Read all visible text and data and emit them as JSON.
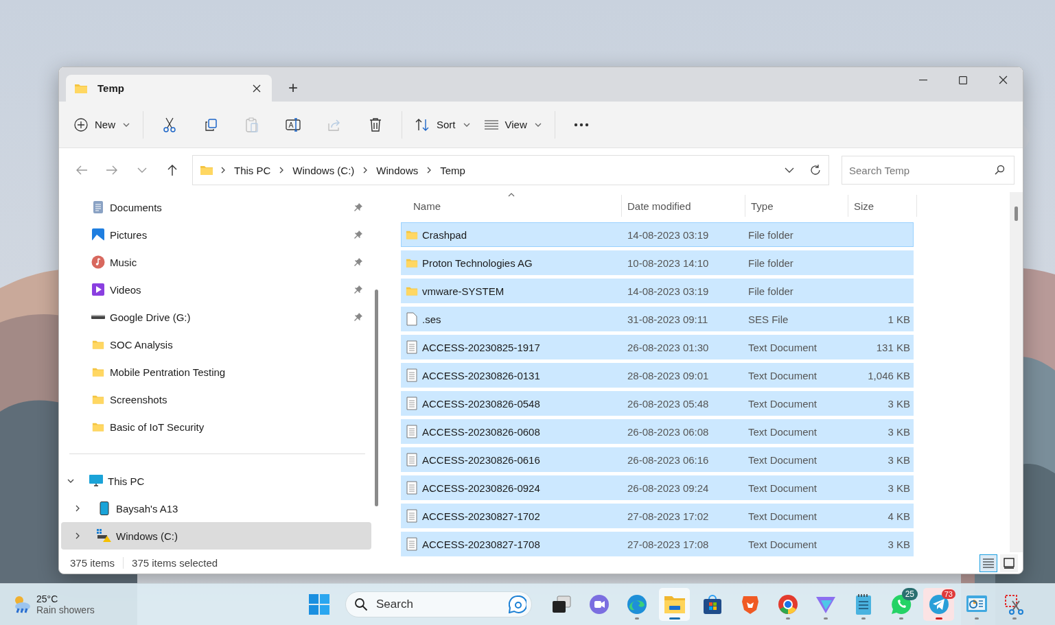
{
  "window": {
    "tab": {
      "title": "Temp",
      "selected": true
    },
    "new_tab": "+"
  },
  "toolbar": [
    {
      "kind": "new",
      "label": "New",
      "disabled": false
    },
    {
      "kind": "cut",
      "disabled": false
    },
    {
      "kind": "copy",
      "disabled": false
    },
    {
      "kind": "paste",
      "disabled": true
    },
    {
      "kind": "rename",
      "disabled": false
    },
    {
      "kind": "share",
      "disabled": true
    },
    {
      "kind": "delete",
      "disabled": false
    },
    {
      "kind": "sort",
      "label": "Sort",
      "disabled": false
    },
    {
      "kind": "view",
      "label": "View",
      "disabled": false
    },
    {
      "kind": "more",
      "disabled": false
    }
  ],
  "navigation": [
    {
      "kind": "back",
      "disabled": true
    },
    {
      "kind": "forward",
      "disabled": true
    },
    {
      "kind": "recent",
      "disabled": true
    },
    {
      "kind": "up",
      "disabled": false
    }
  ],
  "breadcrumb": [
    "This PC",
    "Windows (C:)",
    "Windows",
    "Temp"
  ],
  "search": {
    "placeholder": "Search Temp"
  },
  "sidebar": {
    "quick_access": [
      {
        "label": "Documents",
        "kind": "documents",
        "pinned": true
      },
      {
        "label": "Pictures",
        "kind": "pictures",
        "pinned": true
      },
      {
        "label": "Music",
        "kind": "music",
        "pinned": true
      },
      {
        "label": "Videos",
        "kind": "videos",
        "pinned": true
      },
      {
        "label": "Google Drive (G:)",
        "kind": "drive",
        "pinned": true
      },
      {
        "label": "SOC Analysis",
        "kind": "folder",
        "pinned": false
      },
      {
        "label": "Mobile Pentration Testing",
        "kind": "folder",
        "pinned": false
      },
      {
        "label": "Screenshots",
        "kind": "folder",
        "pinned": false
      },
      {
        "label": "Basic of IoT Security",
        "kind": "folder",
        "pinned": false
      }
    ],
    "tree": [
      {
        "label": "This PC",
        "kind": "pc",
        "expanded": true,
        "selected": false,
        "children": [
          {
            "label": "Baysah's A13",
            "kind": "phone",
            "expanded": false,
            "selected": false
          },
          {
            "label": "Windows (C:)",
            "kind": "system-drive",
            "expanded": false,
            "selected": true
          }
        ]
      }
    ]
  },
  "table": {
    "columns": [
      {
        "label": "Name",
        "sorted": true
      },
      {
        "label": "Date modified",
        "sorted": false
      },
      {
        "label": "Type",
        "sorted": false
      },
      {
        "label": "Size",
        "sorted": false
      }
    ],
    "rows": [
      {
        "kind": "folder",
        "name": "Crashpad",
        "date": "14-08-2023 03:19",
        "type": "File folder",
        "selected": true,
        "focused": true
      },
      {
        "kind": "folder",
        "name": "Proton Technologies AG",
        "date": "10-08-2023 14:10",
        "type": "File folder",
        "selected": true,
        "focused": false
      },
      {
        "kind": "folder",
        "name": "vmware-SYSTEM",
        "date": "14-08-2023 03:19",
        "type": "File folder",
        "selected": true,
        "focused": false
      },
      {
        "kind": "file",
        "name": ".ses",
        "date": "31-08-2023 09:11",
        "type": "SES File",
        "size": "1 KB",
        "selected": true,
        "focused": false
      },
      {
        "kind": "text",
        "name": "ACCESS-20230825-1917",
        "date": "26-08-2023 01:30",
        "type": "Text Document",
        "size": "131 KB",
        "selected": true,
        "focused": false
      },
      {
        "kind": "text",
        "name": "ACCESS-20230826-0131",
        "date": "28-08-2023 09:01",
        "type": "Text Document",
        "size": "1,046 KB",
        "selected": true,
        "focused": false
      },
      {
        "kind": "text",
        "name": "ACCESS-20230826-0548",
        "date": "26-08-2023 05:48",
        "type": "Text Document",
        "size": "3 KB",
        "selected": true,
        "focused": false
      },
      {
        "kind": "text",
        "name": "ACCESS-20230826-0608",
        "date": "26-08-2023 06:08",
        "type": "Text Document",
        "size": "3 KB",
        "selected": true,
        "focused": false
      },
      {
        "kind": "text",
        "name": "ACCESS-20230826-0616",
        "date": "26-08-2023 06:16",
        "type": "Text Document",
        "size": "3 KB",
        "selected": true,
        "focused": false
      },
      {
        "kind": "text",
        "name": "ACCESS-20230826-0924",
        "date": "26-08-2023 09:24",
        "type": "Text Document",
        "size": "3 KB",
        "selected": true,
        "focused": false
      },
      {
        "kind": "text",
        "name": "ACCESS-20230827-1702",
        "date": "27-08-2023 17:02",
        "type": "Text Document",
        "size": "4 KB",
        "selected": true,
        "focused": false
      },
      {
        "kind": "text",
        "name": "ACCESS-20230827-1708",
        "date": "27-08-2023 17:08",
        "type": "Text Document",
        "size": "3 KB",
        "selected": true,
        "focused": false
      }
    ]
  },
  "status_bar": {
    "items": "375 items",
    "selection": "375 items selected",
    "views": [
      {
        "kind": "details",
        "selected": true
      },
      {
        "kind": "tiles",
        "selected": false
      }
    ]
  },
  "taskbar": {
    "weather": {
      "temperature": "25°C",
      "condition": "Rain showers"
    },
    "search": {
      "placeholder": "Search"
    },
    "apps": [
      {
        "kind": "start",
        "running": false,
        "active": false,
        "attention": false
      },
      {
        "kind": "search"
      },
      {
        "kind": "task-view",
        "running": false,
        "active": false,
        "attention": false
      },
      {
        "kind": "meet",
        "running": false,
        "active": false,
        "attention": false
      },
      {
        "kind": "edge",
        "running": true,
        "active": false,
        "attention": false
      },
      {
        "kind": "explorer",
        "running": true,
        "active": true,
        "attention": false
      },
      {
        "kind": "store",
        "running": false,
        "active": false,
        "attention": false
      },
      {
        "kind": "brave",
        "running": false,
        "active": false,
        "attention": false
      },
      {
        "kind": "chrome",
        "running": true,
        "active": false,
        "attention": false
      },
      {
        "kind": "vpn",
        "running": true,
        "active": false,
        "attention": false
      },
      {
        "kind": "notepad",
        "running": true,
        "active": false,
        "attention": false
      },
      {
        "kind": "whatsapp",
        "running": true,
        "active": false,
        "attention": false,
        "badge": "25"
      },
      {
        "kind": "telegram",
        "running": true,
        "active": false,
        "attention": true,
        "badge": "73"
      },
      {
        "kind": "dashboard",
        "running": true,
        "active": false,
        "attention": false
      },
      {
        "kind": "snip",
        "running": true,
        "active": false,
        "attention": false
      }
    ]
  }
}
